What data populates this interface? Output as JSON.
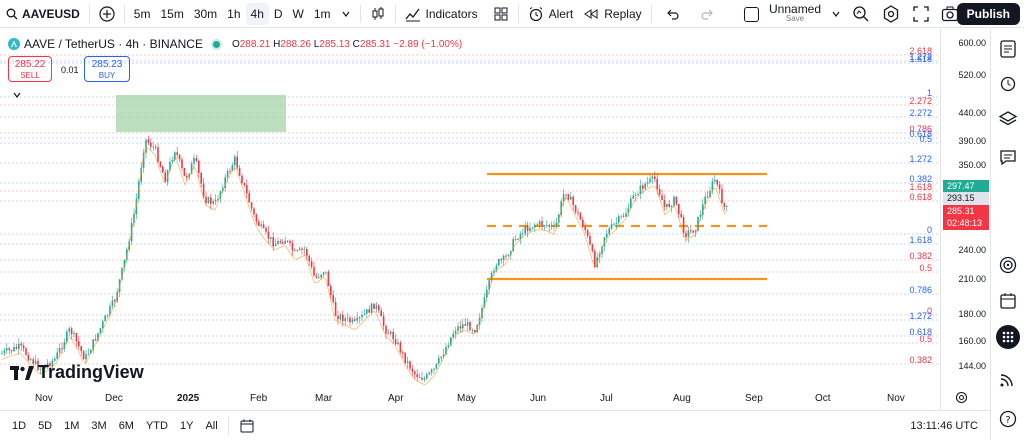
{
  "toolbar": {
    "symbol": "AAVEUSD",
    "intervals": [
      "5m",
      "15m",
      "30m",
      "1h",
      "4h",
      "D",
      "W",
      "1m"
    ],
    "active_interval": "4h",
    "indicators_label": "Indicators",
    "alert_label": "Alert",
    "replay_label": "Replay",
    "layout_name": "Unnamed",
    "layout_status": "Save",
    "publish_label": "Publish"
  },
  "legend": {
    "title": "AAVE / TetherUS · 4h · BINANCE",
    "o_label": "O",
    "o": "288.21",
    "h_label": "H",
    "h": "288.26",
    "l_label": "L",
    "l": "285.13",
    "c_label": "C",
    "c": "285.31",
    "change": "−2.89 (−1.00%)"
  },
  "trade": {
    "sell_price": "285.22",
    "sell_label": "SELL",
    "spread": "0.01",
    "buy_price": "285.23",
    "buy_label": "BUY"
  },
  "price_axis": {
    "labels": [
      "600.00",
      "520.00",
      "440.00",
      "390.00",
      "350.00",
      "240.00",
      "210.00",
      "180.00",
      "160.00",
      "144.00"
    ],
    "tags": [
      {
        "value": "297.47",
        "color": "#22ab94"
      },
      {
        "value": "293.15",
        "color": "#e0e3eb"
      },
      {
        "value": "285.31",
        "color": "#f23645"
      },
      {
        "value": "02:48:13",
        "color": "#f23645"
      }
    ]
  },
  "fib_labels": [
    {
      "text": "2.618",
      "color": "#f23645"
    },
    {
      "text": "1.272",
      "color": "#2962ff"
    },
    {
      "text": "1.618",
      "color": "#2962ff"
    },
    {
      "text": "1",
      "color": "#2962ff"
    },
    {
      "text": "2.272",
      "color": "#f23645"
    },
    {
      "text": "2.272",
      "color": "#2962ff"
    },
    {
      "text": "0.786",
      "color": "#f23645"
    },
    {
      "text": "0.618",
      "color": "#2962ff"
    },
    {
      "text": "0.5",
      "color": "#2962ff"
    },
    {
      "text": "1.272",
      "color": "#2962ff"
    },
    {
      "text": "0.382",
      "color": "#2962ff"
    },
    {
      "text": "1.618",
      "color": "#f23645"
    },
    {
      "text": "0.618",
      "color": "#f23645"
    },
    {
      "text": "0",
      "color": "#2962ff"
    },
    {
      "text": "1.618",
      "color": "#2962ff"
    },
    {
      "text": "0.382",
      "color": "#f23645"
    },
    {
      "text": "0.5",
      "color": "#f23645"
    },
    {
      "text": "0.786",
      "color": "#2962ff"
    },
    {
      "text": "0",
      "color": "#f23645"
    },
    {
      "text": "1.272",
      "color": "#2962ff"
    },
    {
      "text": "0.618",
      "color": "#2962ff"
    },
    {
      "text": "0.5",
      "color": "#f23645"
    },
    {
      "text": "0.382",
      "color": "#f23645"
    }
  ],
  "time_axis": [
    "Nov",
    "Dec",
    "2025",
    "Feb",
    "Mar",
    "Apr",
    "May",
    "Jun",
    "Jul",
    "Aug",
    "Sep",
    "Oct",
    "Nov"
  ],
  "bottom": {
    "ranges": [
      "1D",
      "5D",
      "1M",
      "3M",
      "6M",
      "YTD",
      "1Y",
      "All"
    ],
    "clock": "13:11:46 UTC"
  },
  "brand": "TradingView",
  "colors": {
    "up": "#22ab94",
    "down": "#f23645",
    "level": "#f7931a",
    "zone": "#a5d6a7"
  }
}
